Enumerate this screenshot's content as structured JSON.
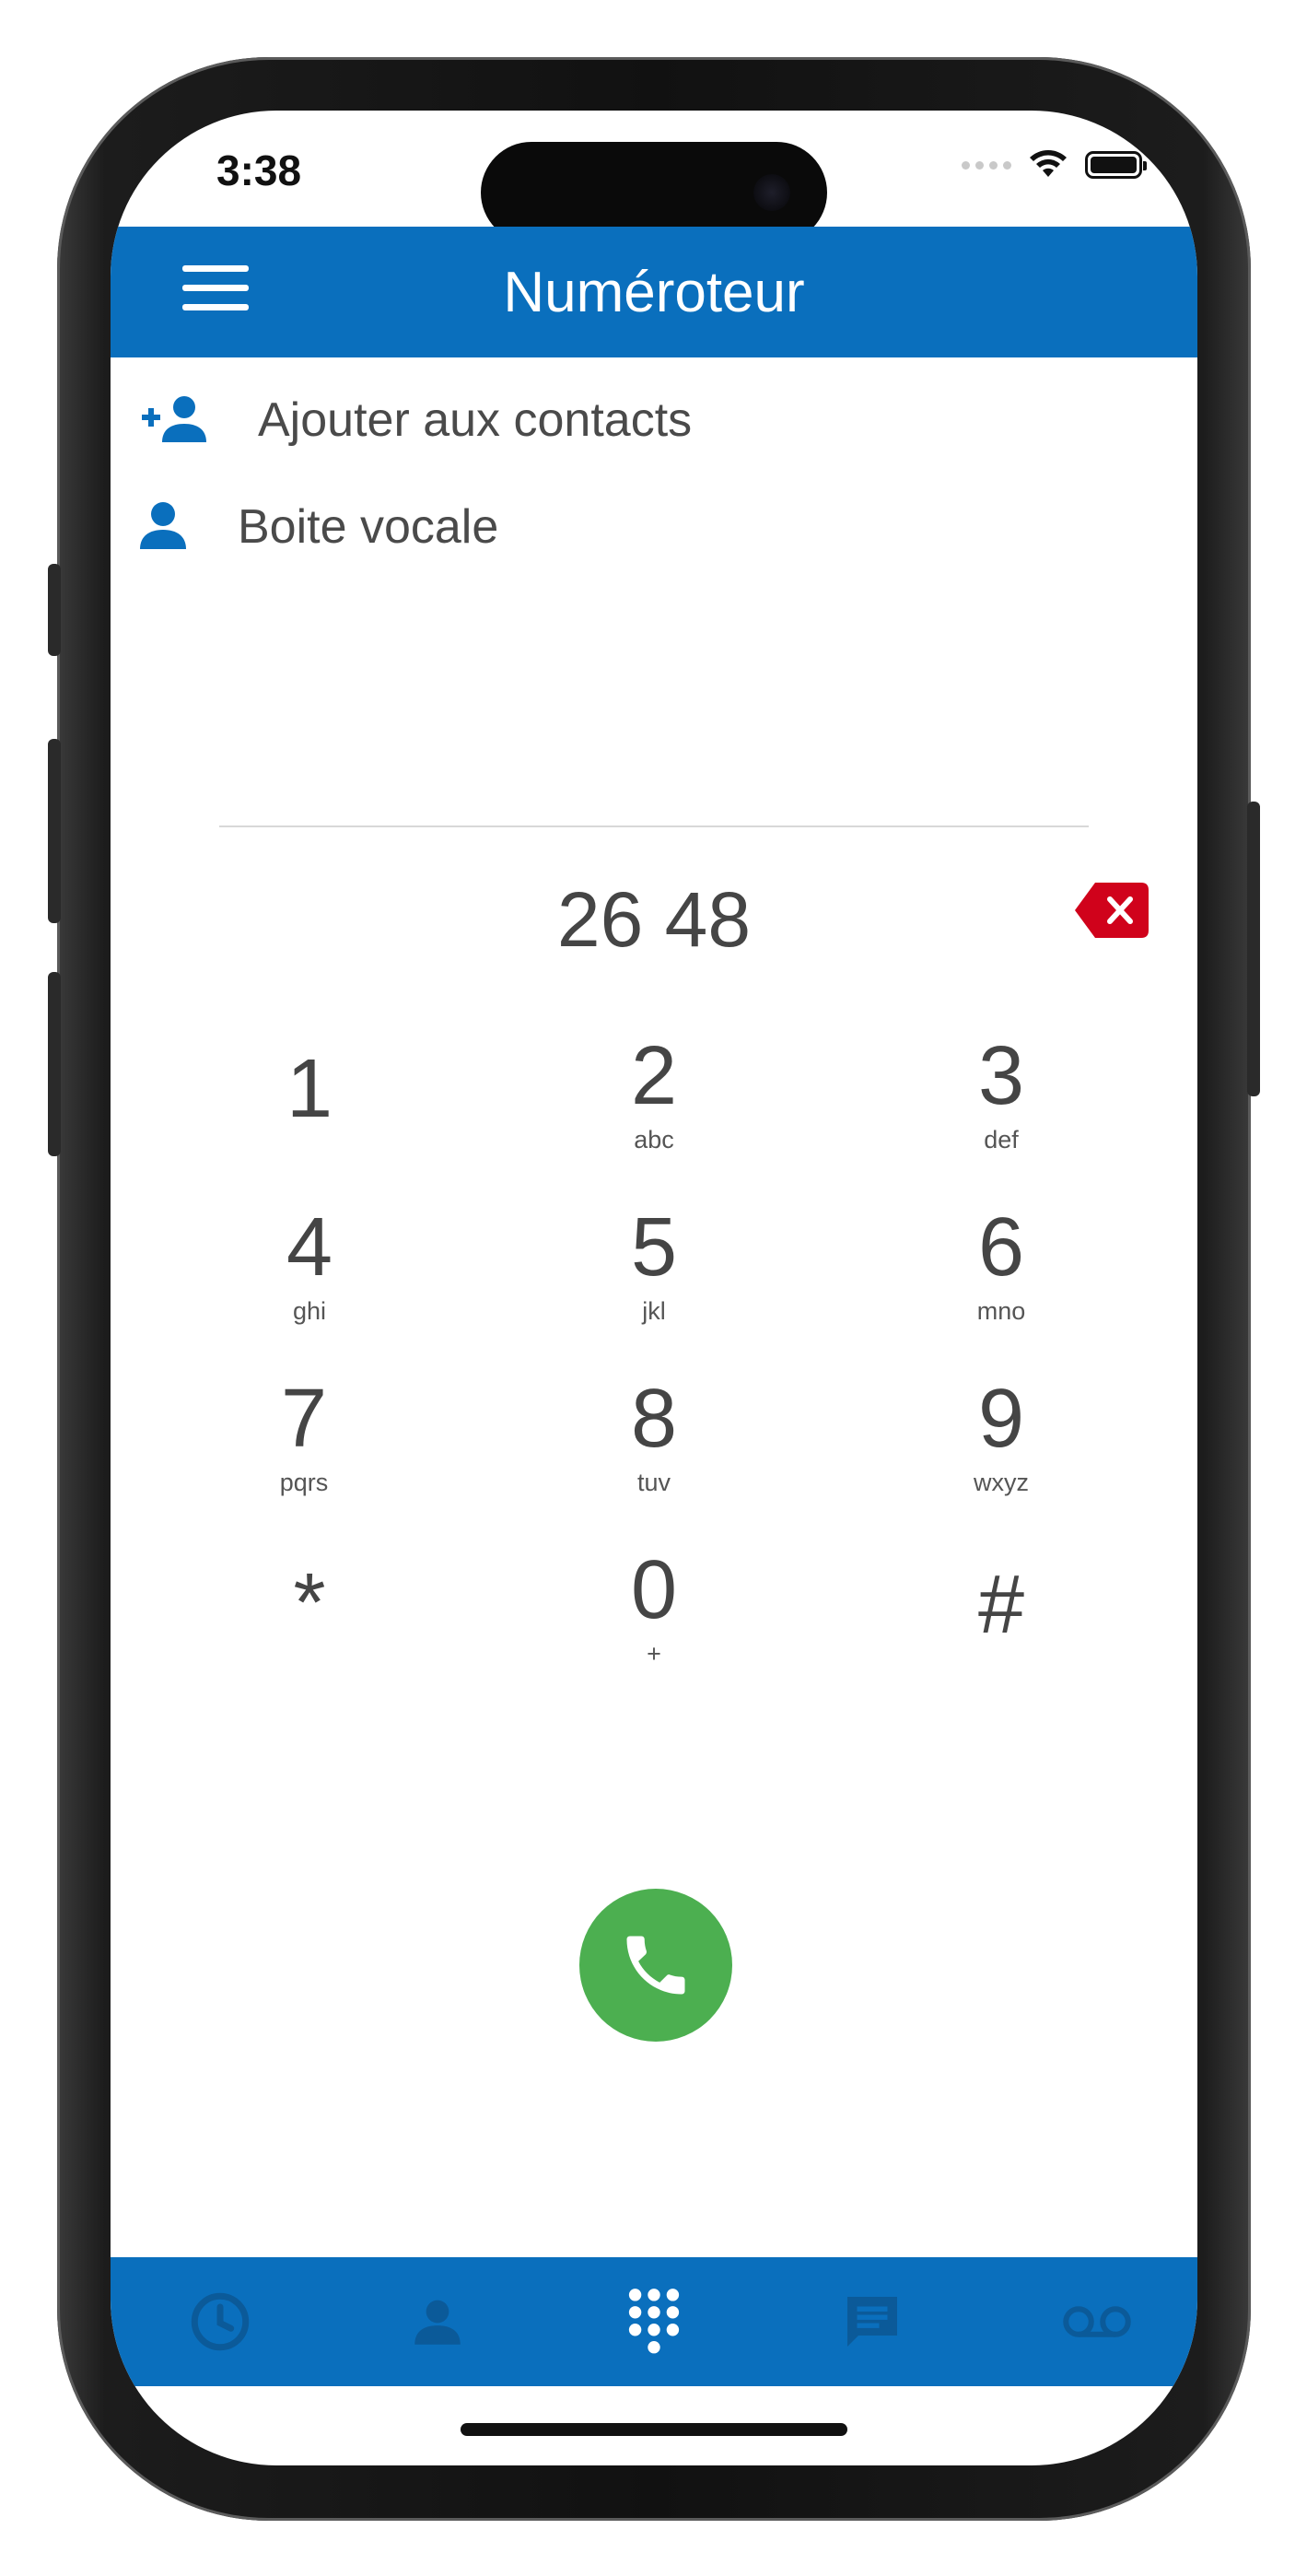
{
  "status": {
    "time": "3:38"
  },
  "header": {
    "title": "Numéroteur"
  },
  "actions": {
    "add_contact": "Ajouter aux contacts",
    "voicemail": "Boite vocale"
  },
  "dialer": {
    "number": "26 48",
    "keys": [
      {
        "digit": "1",
        "letters": ""
      },
      {
        "digit": "2",
        "letters": "abc"
      },
      {
        "digit": "3",
        "letters": "def"
      },
      {
        "digit": "4",
        "letters": "ghi"
      },
      {
        "digit": "5",
        "letters": "jkl"
      },
      {
        "digit": "6",
        "letters": "mno"
      },
      {
        "digit": "7",
        "letters": "pqrs"
      },
      {
        "digit": "8",
        "letters": "tuv"
      },
      {
        "digit": "9",
        "letters": "wxyz"
      },
      {
        "digit": "*",
        "letters": ""
      },
      {
        "digit": "0",
        "letters": "+"
      },
      {
        "digit": "#",
        "letters": ""
      }
    ]
  },
  "tabs": [
    {
      "icon": "clock-icon",
      "active": false
    },
    {
      "icon": "person-icon",
      "active": false
    },
    {
      "icon": "dialpad-icon",
      "active": true
    },
    {
      "icon": "message-icon",
      "active": false
    },
    {
      "icon": "voicemail-icon",
      "active": false
    }
  ],
  "colors": {
    "primary": "#0a6fbd",
    "tab_inactive": "#0b5a99",
    "tab_active": "#ffffff",
    "call": "#4caf50",
    "delete": "#d0021b"
  }
}
